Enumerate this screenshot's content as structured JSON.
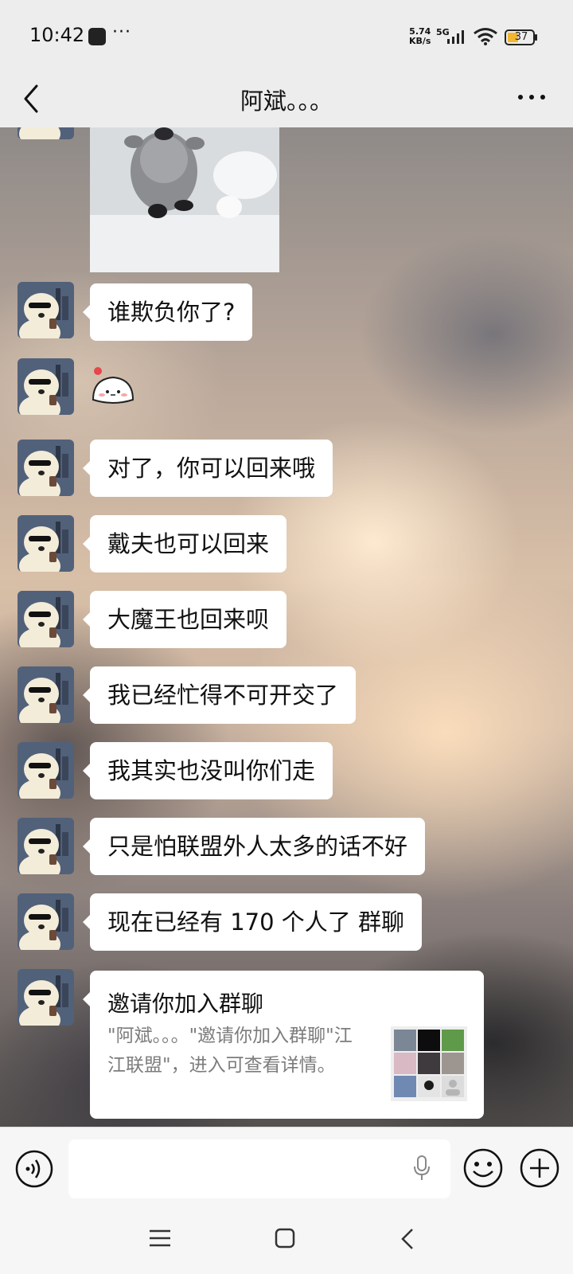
{
  "status_bar": {
    "time": "10:42",
    "more": "···",
    "net_speed_value": "5.74",
    "net_speed_unit": "KB/s",
    "network": "5G",
    "battery": "37"
  },
  "header": {
    "title": "阿斌。。。"
  },
  "messages": [
    {
      "type": "image",
      "icon": "penguin-chick-photo"
    },
    {
      "type": "text",
      "text": "谁欺负你了?"
    },
    {
      "type": "sticker",
      "icon": "round-white-creature-sticker"
    },
    {
      "type": "text",
      "text": "对了，你可以回来哦"
    },
    {
      "type": "text",
      "text": "戴夫也可以回来"
    },
    {
      "type": "text",
      "text": "大魔王也回来呗"
    },
    {
      "type": "text",
      "text": "我已经忙得不可开交了"
    },
    {
      "type": "text",
      "text": "我其实也没叫你们走"
    },
    {
      "type": "text",
      "text": "只是怕联盟外人太多的话不好"
    },
    {
      "type": "text",
      "text": "现在已经有 170 个人了 群聊"
    }
  ],
  "invite_card": {
    "title": "邀请你加入群聊",
    "description": "\"阿斌。。。\"邀请你加入群聊\"江江联盟\"，进入可查看详情。"
  },
  "input_bar": {
    "placeholder": ""
  },
  "colors": {
    "page_background": "#ededed",
    "bubble": "#ffffff",
    "text": "#111111",
    "secondary_text": "#7c7c7c"
  }
}
